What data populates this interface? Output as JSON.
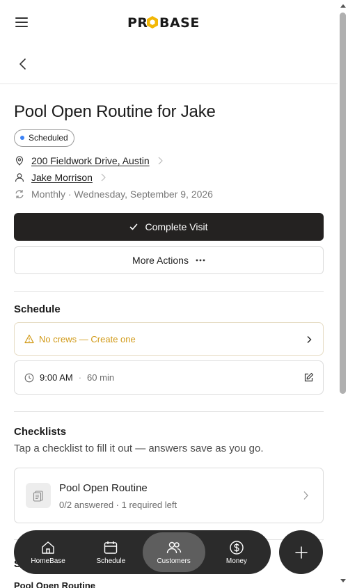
{
  "header": {
    "logo_text": "PROBASE",
    "menu_icon": "hamburger-icon",
    "back_icon": "chevron-left-icon"
  },
  "visit": {
    "title": "Pool Open Routine for Jake",
    "status": "Scheduled",
    "status_color": "#3b82f6",
    "address": "200 Fieldwork Drive, Austin",
    "customer": "Jake Morrison",
    "recurrence": "Monthly · Wednesday, September 9, 2026"
  },
  "actions": {
    "complete_label": "Complete Visit",
    "more_label": "More Actions"
  },
  "schedule": {
    "title": "Schedule",
    "crew_warning": "No crews — Create one",
    "warning_color": "#d19a18",
    "time": "9:00 AM",
    "separator": "·",
    "duration": "60 min"
  },
  "checklists": {
    "title": "Checklists",
    "subtitle": "Tap a checklist to fill it out — answers save as you go.",
    "items": [
      {
        "name": "Pool Open Routine",
        "status": "0/2 answered · 1 required left"
      }
    ]
  },
  "peek": {
    "section_initial": "S",
    "line": "Pool Open Routine"
  },
  "nav": {
    "items": [
      {
        "label": "HomeBase",
        "icon": "home-icon"
      },
      {
        "label": "Schedule",
        "icon": "calendar-icon"
      },
      {
        "label": "Customers",
        "icon": "users-icon",
        "active": true
      },
      {
        "label": "Money",
        "icon": "dollar-icon"
      }
    ],
    "fab_icon": "plus-icon"
  }
}
